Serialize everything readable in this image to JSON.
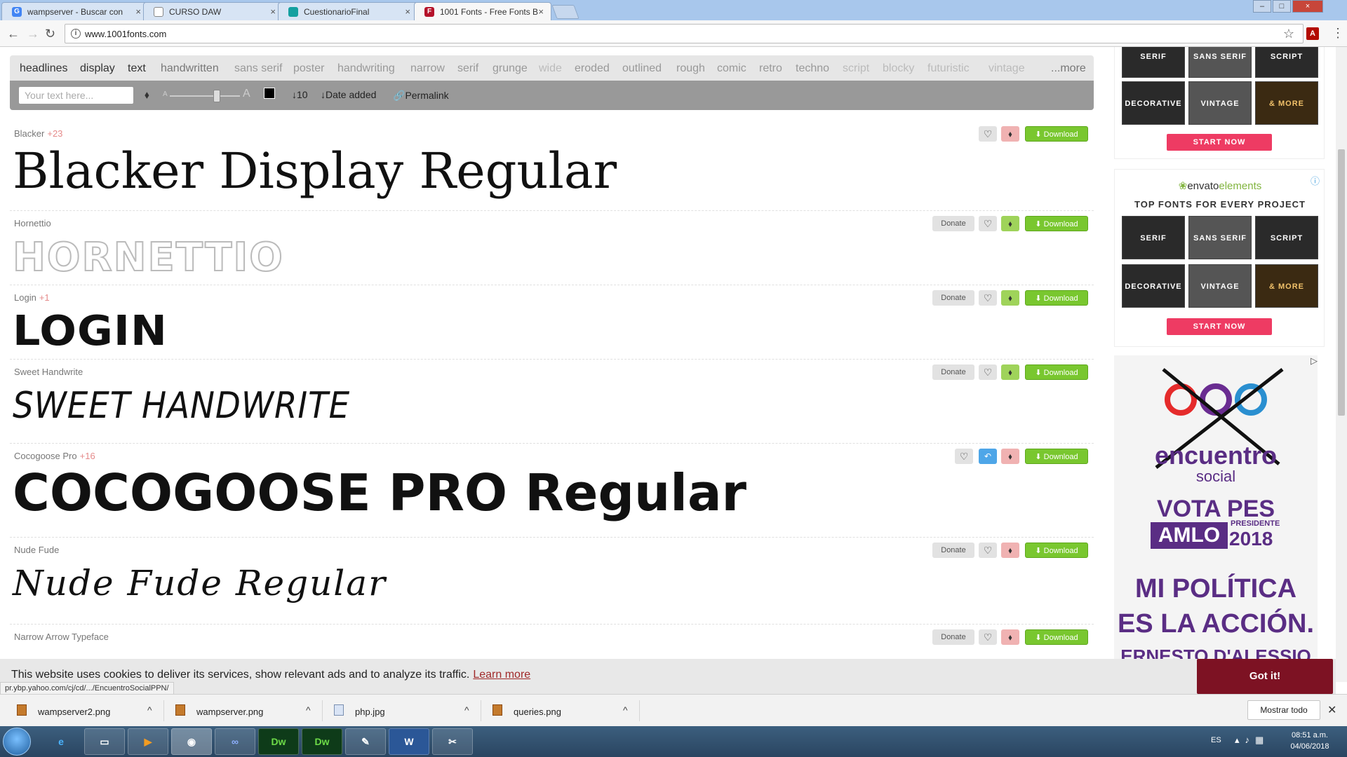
{
  "browser": {
    "tabs": [
      {
        "title": "wampserver - Buscar con",
        "favicon": "G",
        "active": false
      },
      {
        "title": "CURSO DAW",
        "favicon": "",
        "active": false
      },
      {
        "title": "CuestionarioFinal",
        "favicon": "",
        "active": false
      },
      {
        "title": "1001 Fonts - Free Fonts B",
        "favicon": "F",
        "active": true
      }
    ],
    "url": "www.1001fonts.com"
  },
  "filter": {
    "categories": [
      "headlines",
      "display",
      "text",
      "handwritten",
      "sans serif",
      "poster",
      "handwriting",
      "narrow",
      "serif",
      "grunge",
      "wide",
      "eroded",
      "outlined",
      "rough",
      "comic",
      "retro",
      "techno",
      "script",
      "blocky",
      "futuristic",
      "vintage"
    ],
    "more": "...more",
    "text_placeholder": "Your text here...",
    "count": "↓10",
    "sort": "↓Date added",
    "permalink": "Permalink"
  },
  "actions": {
    "donate": "Donate",
    "download": "Download"
  },
  "fonts": [
    {
      "name": "Blacker",
      "plus": "+23",
      "preview": "Blacker Display Regular",
      "donate": false
    },
    {
      "name": "Hornettio",
      "plus": "",
      "preview": "HORNETTIO",
      "donate": true
    },
    {
      "name": "Login",
      "plus": "+1",
      "preview": "LOGIN",
      "donate": true
    },
    {
      "name": "Sweet Handwrite",
      "plus": "",
      "preview": "SWEET HANDWRITE",
      "donate": true
    },
    {
      "name": "Cocogoose Pro",
      "plus": "+16",
      "preview": "COCOGOOSE PRO Regular",
      "donate": false
    },
    {
      "name": "Nude Fude",
      "plus": "",
      "preview": "Nude Fude Regular",
      "donate": true
    },
    {
      "name": "Narrow Arrow Typeface",
      "plus": "",
      "preview": "",
      "donate": true
    }
  ],
  "ads": {
    "envato": "envato",
    "envato_suffix": "elements",
    "heading": "TOP FONTS FOR EVERY PROJECT",
    "tiles": [
      "SERIF",
      "SANS SERIF",
      "SCRIPT",
      "DECORATIVE",
      "VINTAGE",
      "& MORE"
    ],
    "cta": "START NOW",
    "pes": {
      "brand": "encuentro",
      "brand2": "social",
      "line1": "VOTA PES",
      "line2": "AMLO",
      "line2_sub": "PRESIDENTE",
      "year": "2018",
      "slogan1": "MI POLÍTICA",
      "slogan2": "ES LA ACCIÓN.",
      "signature": "ERNESTO D'ALESSIO"
    }
  },
  "cookie": {
    "text": "This website uses cookies to deliver its services, show relevant ads and to analyze its traffic.",
    "link": "Learn more",
    "button": "Got it!"
  },
  "status_url": "pr.ybp.yahoo.com/cj/cd/.../EncuentroSocialPPN/",
  "downloads": {
    "items": [
      "wampserver2.png",
      "wampserver.png",
      "php.jpg",
      "queries.png"
    ],
    "show_all": "Mostrar todo"
  },
  "taskbar": {
    "lang": "ES",
    "time": "08:51 a.m.",
    "date": "04/06/2018",
    "dw_label": "Dw",
    "word_label": "W"
  },
  "colors": {
    "accent_download": "#79c72f",
    "cookie_button": "#7d1223",
    "start_now": "#ee3b63",
    "pes_purple": "#5a2d84"
  }
}
